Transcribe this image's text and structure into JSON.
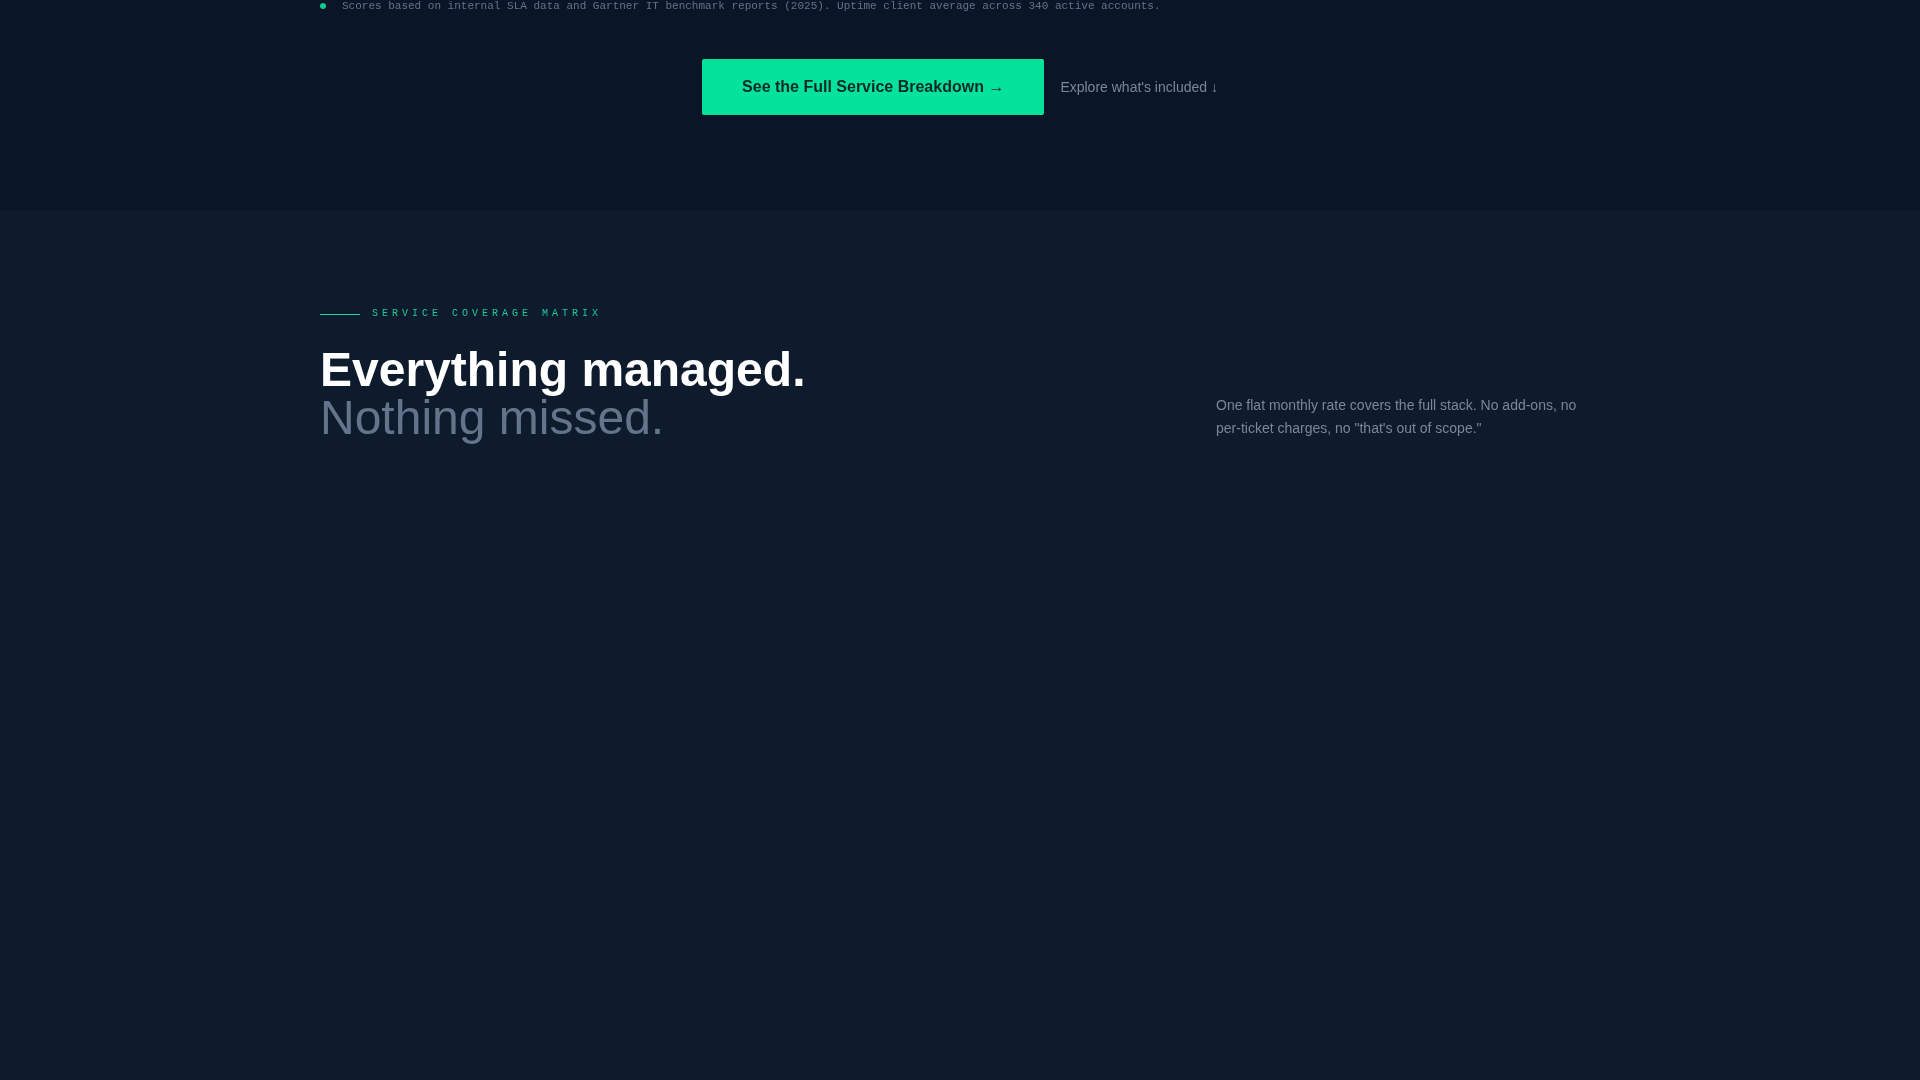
{
  "footnote": {
    "text": "Scores based on internal SLA data and Gartner IT benchmark reports (2025). Uptime client average across 340 active accounts."
  },
  "cta": {
    "button": "See the Full Service Breakdown →",
    "link": "Explore what's included ↓"
  },
  "section": {
    "eyebrow": "SERVICE COVERAGE MATRIX",
    "heading": [
      "Everything managed.",
      "Nothing missed."
    ],
    "description": "One flat monthly rate covers the full stack. No add-ons, no per-ticket charges, no \"that's out of scope.\""
  }
}
